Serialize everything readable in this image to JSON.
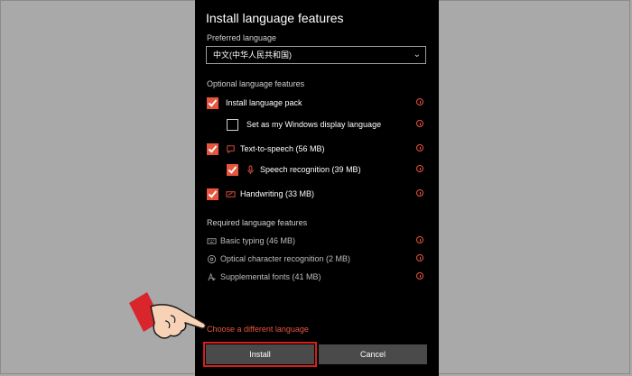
{
  "dialog": {
    "title": "Install language features",
    "preferred_language_label": "Preferred language",
    "preferred_language_value": "中文(中华人民共和国)",
    "optional_section_label": "Optional language features",
    "optional_features": [
      {
        "label": "Install language pack",
        "checked": true
      },
      {
        "label": "Set as my Windows display language",
        "checked": false
      },
      {
        "label": "Text-to-speech (56 MB)",
        "checked": true,
        "icon": "speech-bubble-icon"
      },
      {
        "label": "Speech recognition (39 MB)",
        "checked": true,
        "icon": "microphone-icon"
      },
      {
        "label": "Handwriting (33 MB)",
        "checked": true,
        "icon": "handwriting-icon"
      }
    ],
    "required_section_label": "Required language features",
    "required_features": [
      {
        "label": "Basic typing (46 MB)",
        "icon": "keyboard-icon"
      },
      {
        "label": "Optical character recognition (2 MB)",
        "icon": "ocr-icon"
      },
      {
        "label": "Supplemental fonts (41 MB)",
        "icon": "font-icon"
      }
    ],
    "change_language_link": "Choose a different language",
    "install_label": "Install",
    "cancel_label": "Cancel"
  },
  "colors": {
    "accent": "#e8553e",
    "dialog_background": "#000000",
    "page_background": "#a9a9a9",
    "highlight": "#d81d1d"
  }
}
